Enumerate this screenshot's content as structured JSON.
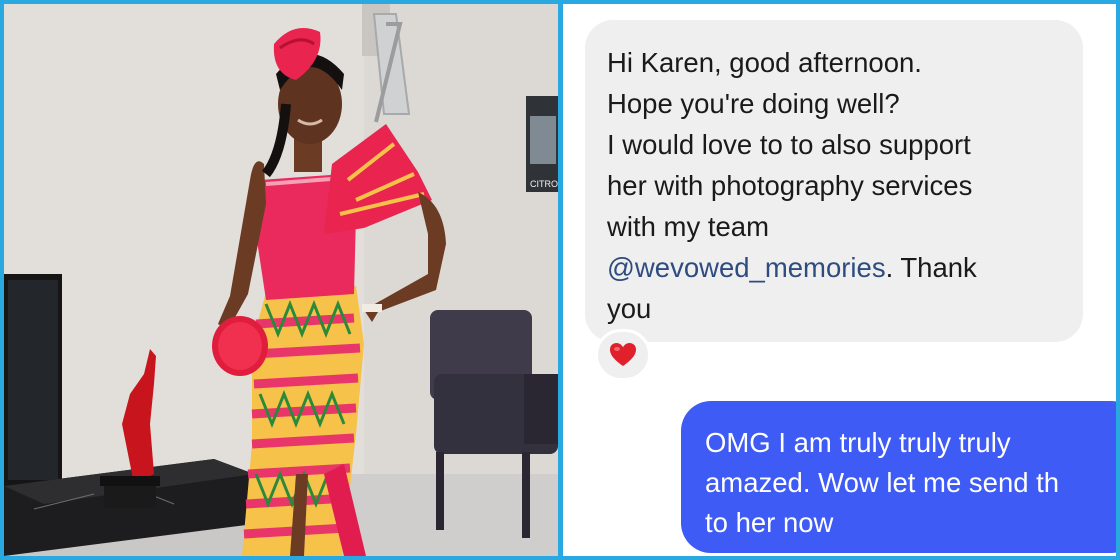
{
  "incoming_message": {
    "lines": [
      "Hi Karen, good afternoon.",
      "Hope you're doing well?",
      "I would love to to also support",
      "her with photography services",
      "with my team"
    ],
    "mention": "@wevowed_memories",
    "after_mention": ". Thank",
    "last_line": "you",
    "reaction": "❤️"
  },
  "outgoing_message": {
    "lines": [
      "OMG I am truly truly truly",
      "amazed. Wow let me send th",
      "to her now"
    ]
  },
  "photo": {
    "wall_sign_text": "CITRO"
  },
  "colors": {
    "border": "#2aa8e0",
    "incoming_bubble": "#efefef",
    "outgoing_bubble": "#3e5bf6",
    "mention": "#2f4c7f",
    "reaction_heart": "#e0202a"
  }
}
